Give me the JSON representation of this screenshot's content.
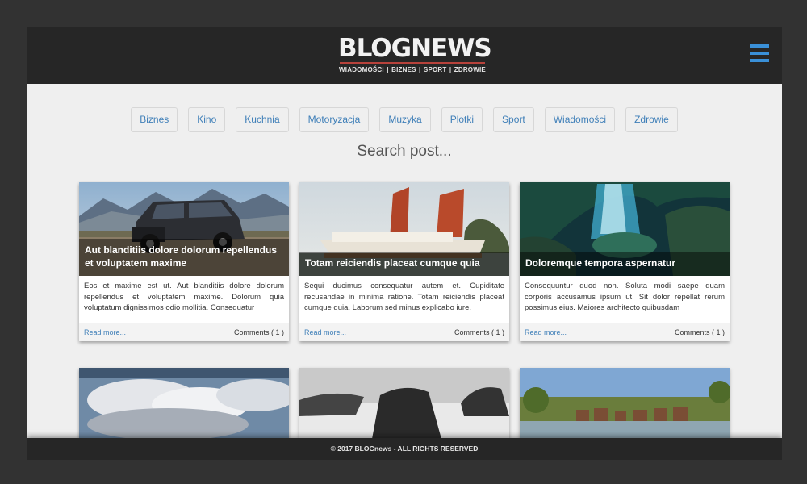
{
  "header": {
    "logo": "BLOGNEWS",
    "tagline": "WIADOMOŚCI | BIZNES | SPORT | ZDROWIE",
    "menu_icon": "hamburger-icon",
    "menu_color": "#3a90d8"
  },
  "categories": [
    "Biznes",
    "Kino",
    "Kuchnia",
    "Motoryzacja",
    "Muzyka",
    "Plotki",
    "Sport",
    "Wiadomości",
    "Zdrowie"
  ],
  "search": {
    "label": "Search post..."
  },
  "posts": [
    {
      "title": "Aut blanditiis dolore dolorum repellendus et voluptatem maxime",
      "excerpt": "Eos et maxime est ut. Aut blanditiis dolore dolorum repellendus et voluptatem maxime. Dolorum quia voluptatum dignissimos odio mollitia. Consequatur",
      "read_more": "Read more...",
      "comments": "Comments ( 1 )"
    },
    {
      "title": "Totam reiciendis placeat cumque quia",
      "excerpt": "Sequi ducimus consequatur autem et. Cupiditate recusandae in minima ratione. Totam reiciendis placeat cumque quia. Laborum sed minus explicabo iure.",
      "read_more": "Read more...",
      "comments": "Comments ( 1 )"
    },
    {
      "title": "Doloremque tempora aspernatur",
      "excerpt": "Consequuntur quod non. Soluta modi saepe quam corporis accusamus ipsum ut. Sit dolor repellat rerum possimus eius. Maiores architecto quibusdam",
      "read_more": "Read more...",
      "comments": "Comments ( 1 )"
    }
  ],
  "footer": {
    "text": "© 2017 BLOGnews - ALL RIGHTS RESERVED"
  },
  "colors": {
    "accent": "#3f7fb8",
    "header_bg": "#262626",
    "page_bg": "#efefef",
    "logo_underline": "#b7423b"
  }
}
